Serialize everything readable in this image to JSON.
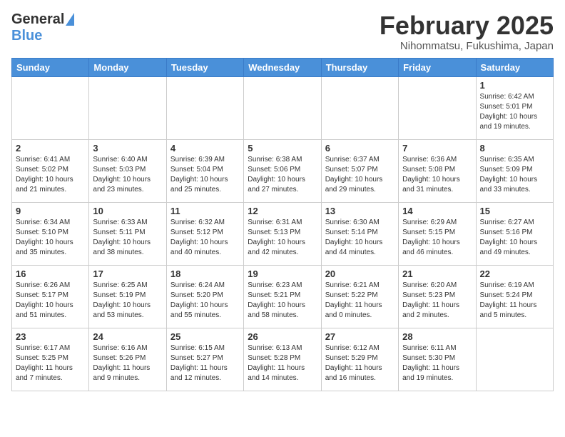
{
  "header": {
    "logo_general": "General",
    "logo_blue": "Blue",
    "month": "February 2025",
    "location": "Nihommatsu, Fukushima, Japan"
  },
  "days_of_week": [
    "Sunday",
    "Monday",
    "Tuesday",
    "Wednesday",
    "Thursday",
    "Friday",
    "Saturday"
  ],
  "weeks": [
    [
      {
        "day": "",
        "info": ""
      },
      {
        "day": "",
        "info": ""
      },
      {
        "day": "",
        "info": ""
      },
      {
        "day": "",
        "info": ""
      },
      {
        "day": "",
        "info": ""
      },
      {
        "day": "",
        "info": ""
      },
      {
        "day": "1",
        "info": "Sunrise: 6:42 AM\nSunset: 5:01 PM\nDaylight: 10 hours and 19 minutes."
      }
    ],
    [
      {
        "day": "2",
        "info": "Sunrise: 6:41 AM\nSunset: 5:02 PM\nDaylight: 10 hours and 21 minutes."
      },
      {
        "day": "3",
        "info": "Sunrise: 6:40 AM\nSunset: 5:03 PM\nDaylight: 10 hours and 23 minutes."
      },
      {
        "day": "4",
        "info": "Sunrise: 6:39 AM\nSunset: 5:04 PM\nDaylight: 10 hours and 25 minutes."
      },
      {
        "day": "5",
        "info": "Sunrise: 6:38 AM\nSunset: 5:06 PM\nDaylight: 10 hours and 27 minutes."
      },
      {
        "day": "6",
        "info": "Sunrise: 6:37 AM\nSunset: 5:07 PM\nDaylight: 10 hours and 29 minutes."
      },
      {
        "day": "7",
        "info": "Sunrise: 6:36 AM\nSunset: 5:08 PM\nDaylight: 10 hours and 31 minutes."
      },
      {
        "day": "8",
        "info": "Sunrise: 6:35 AM\nSunset: 5:09 PM\nDaylight: 10 hours and 33 minutes."
      }
    ],
    [
      {
        "day": "9",
        "info": "Sunrise: 6:34 AM\nSunset: 5:10 PM\nDaylight: 10 hours and 35 minutes."
      },
      {
        "day": "10",
        "info": "Sunrise: 6:33 AM\nSunset: 5:11 PM\nDaylight: 10 hours and 38 minutes."
      },
      {
        "day": "11",
        "info": "Sunrise: 6:32 AM\nSunset: 5:12 PM\nDaylight: 10 hours and 40 minutes."
      },
      {
        "day": "12",
        "info": "Sunrise: 6:31 AM\nSunset: 5:13 PM\nDaylight: 10 hours and 42 minutes."
      },
      {
        "day": "13",
        "info": "Sunrise: 6:30 AM\nSunset: 5:14 PM\nDaylight: 10 hours and 44 minutes."
      },
      {
        "day": "14",
        "info": "Sunrise: 6:29 AM\nSunset: 5:15 PM\nDaylight: 10 hours and 46 minutes."
      },
      {
        "day": "15",
        "info": "Sunrise: 6:27 AM\nSunset: 5:16 PM\nDaylight: 10 hours and 49 minutes."
      }
    ],
    [
      {
        "day": "16",
        "info": "Sunrise: 6:26 AM\nSunset: 5:17 PM\nDaylight: 10 hours and 51 minutes."
      },
      {
        "day": "17",
        "info": "Sunrise: 6:25 AM\nSunset: 5:19 PM\nDaylight: 10 hours and 53 minutes."
      },
      {
        "day": "18",
        "info": "Sunrise: 6:24 AM\nSunset: 5:20 PM\nDaylight: 10 hours and 55 minutes."
      },
      {
        "day": "19",
        "info": "Sunrise: 6:23 AM\nSunset: 5:21 PM\nDaylight: 10 hours and 58 minutes."
      },
      {
        "day": "20",
        "info": "Sunrise: 6:21 AM\nSunset: 5:22 PM\nDaylight: 11 hours and 0 minutes."
      },
      {
        "day": "21",
        "info": "Sunrise: 6:20 AM\nSunset: 5:23 PM\nDaylight: 11 hours and 2 minutes."
      },
      {
        "day": "22",
        "info": "Sunrise: 6:19 AM\nSunset: 5:24 PM\nDaylight: 11 hours and 5 minutes."
      }
    ],
    [
      {
        "day": "23",
        "info": "Sunrise: 6:17 AM\nSunset: 5:25 PM\nDaylight: 11 hours and 7 minutes."
      },
      {
        "day": "24",
        "info": "Sunrise: 6:16 AM\nSunset: 5:26 PM\nDaylight: 11 hours and 9 minutes."
      },
      {
        "day": "25",
        "info": "Sunrise: 6:15 AM\nSunset: 5:27 PM\nDaylight: 11 hours and 12 minutes."
      },
      {
        "day": "26",
        "info": "Sunrise: 6:13 AM\nSunset: 5:28 PM\nDaylight: 11 hours and 14 minutes."
      },
      {
        "day": "27",
        "info": "Sunrise: 6:12 AM\nSunset: 5:29 PM\nDaylight: 11 hours and 16 minutes."
      },
      {
        "day": "28",
        "info": "Sunrise: 6:11 AM\nSunset: 5:30 PM\nDaylight: 11 hours and 19 minutes."
      },
      {
        "day": "",
        "info": ""
      }
    ]
  ]
}
